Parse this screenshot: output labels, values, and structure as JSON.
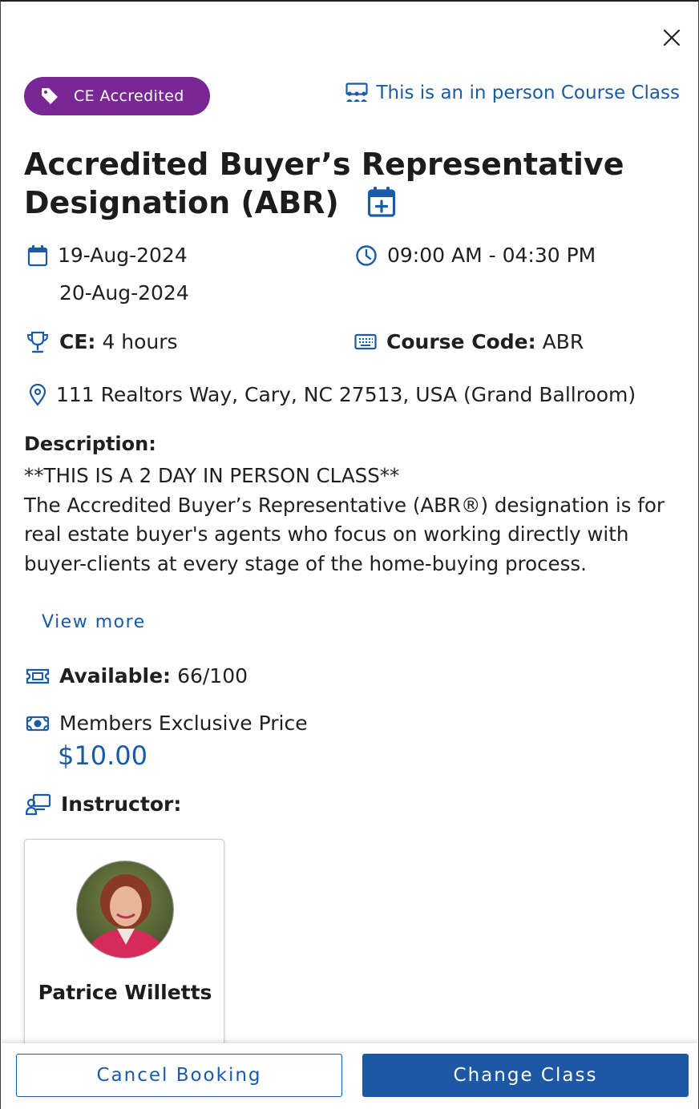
{
  "close": {
    "icon": "close-icon"
  },
  "badge": {
    "label": "CE Accredited",
    "icon": "tag-icon",
    "color": "#7a2796"
  },
  "class_type": {
    "label": "This is an in person Course Class",
    "icon": "classroom-icon",
    "color": "#1a5aa6"
  },
  "course": {
    "title": "Accredited Buyer’s Representative Designation (ABR)",
    "add_calendar_icon": "calendar-add-icon"
  },
  "schedule": {
    "dates": [
      "19-Aug-2024",
      "20-Aug-2024"
    ],
    "time": "09:00 AM - 04:30 PM"
  },
  "ce": {
    "label": "CE:",
    "value": "4 hours"
  },
  "course_code": {
    "label": "Course Code:",
    "value": "ABR"
  },
  "location": "111 Realtors Way, Cary, NC 27513, USA (Grand Ballroom)",
  "description": {
    "heading": "Description:",
    "lines": [
      "**THIS IS A 2 DAY IN PERSON CLASS**",
      "The Accredited Buyer’s Representative (ABR®) designation is for real estate buyer's agents who focus on working directly with buyer-clients at every stage of the home-buying process."
    ],
    "view_more": "View more"
  },
  "availability": {
    "label": "Available:",
    "value": "66/100"
  },
  "pricing": {
    "label": "Members Exclusive Price",
    "value": "$10.00"
  },
  "instructor": {
    "heading": "Instructor:",
    "name": "Patrice Willetts"
  },
  "footer": {
    "cancel_label": "Cancel Booking",
    "change_label": "Change Class",
    "primary_color": "#1c58a4"
  }
}
